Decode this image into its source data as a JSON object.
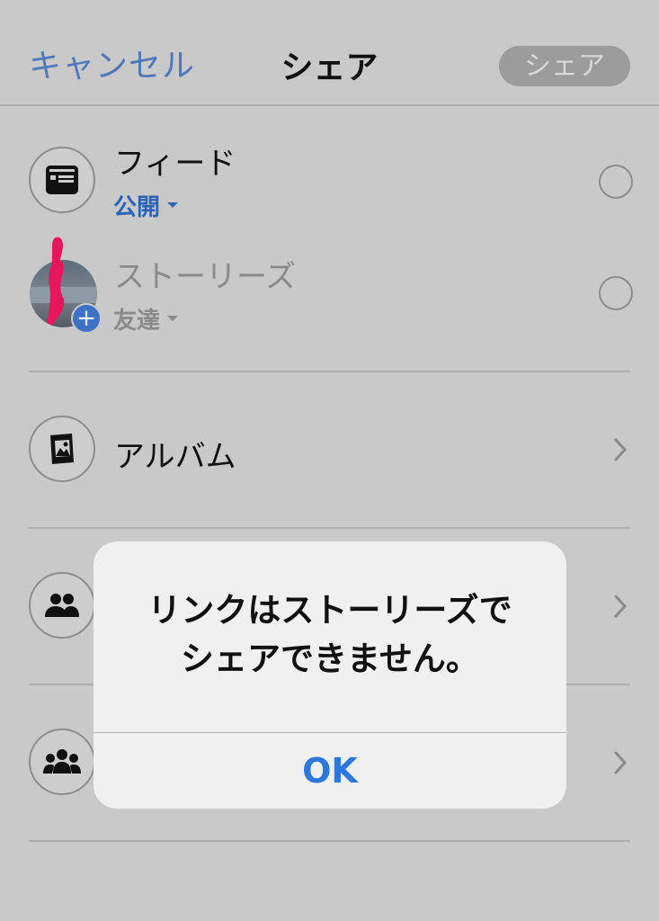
{
  "header": {
    "cancel_label": "キャンセル",
    "title": "シェア",
    "share_label": "シェア"
  },
  "feed": {
    "label": "フィード",
    "privacy": "公開",
    "icon": "news-feed-icon"
  },
  "stories": {
    "label": "ストーリーズ",
    "privacy": "友達",
    "icon": "profile-avatar"
  },
  "album": {
    "label": "アルバム",
    "icon": "album-icon"
  },
  "hidden_rows": [
    {
      "icon": "group-icon"
    },
    {
      "icon": "groups-icon"
    }
  ],
  "dialog": {
    "message_line1": "リンクはストーリーズで",
    "message_line2": "シェアできません。",
    "ok_label": "OK"
  },
  "colors": {
    "accent": "#2b77dd",
    "privacy_blue": "#2d63b7",
    "cancel_blue": "#4f78ba",
    "dimmed_text": "#8a8a8a",
    "overlay_background": "#c9c9c9"
  }
}
